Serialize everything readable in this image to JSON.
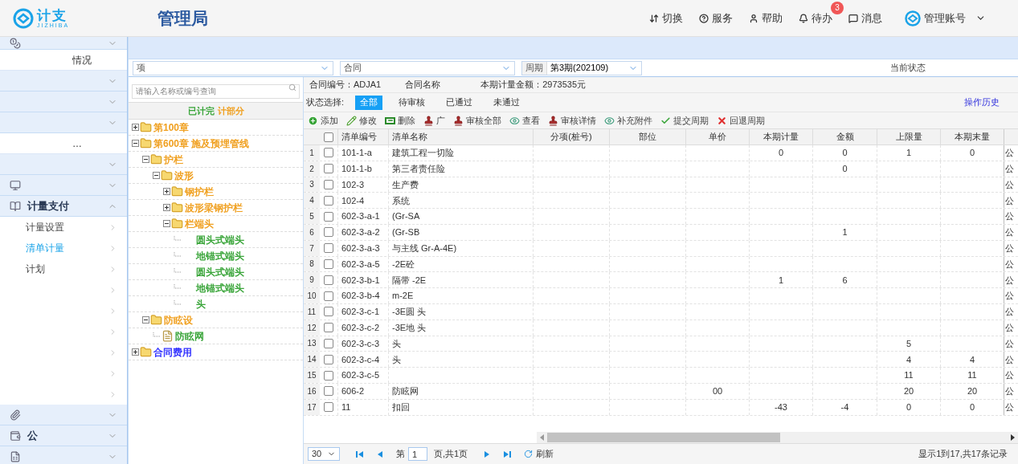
{
  "header": {
    "logo_text": "计支",
    "logo_subtext": "JIZHIBA",
    "title": "管理局",
    "nav": [
      {
        "kind": "switch",
        "label": "切换"
      },
      {
        "kind": "help",
        "label": "服务"
      },
      {
        "kind": "user",
        "label": "帮助"
      },
      {
        "kind": "bell",
        "label": "待办",
        "badge": "3"
      },
      {
        "kind": "message",
        "label": "消息"
      }
    ],
    "account": "管理账号"
  },
  "sidebar": {
    "items": [
      {
        "kind": "group",
        "expanded": false
      },
      {
        "kind": "link",
        "label": "情况",
        "selected": false
      },
      {
        "kind": "group",
        "expanded": false
      },
      {
        "kind": "group",
        "expanded": false
      },
      {
        "kind": "group",
        "expanded": false
      },
      {
        "kind": "link",
        "label": "…",
        "selected": false
      },
      {
        "kind": "group",
        "expanded": false
      },
      {
        "kind": "group",
        "expanded": false
      },
      {
        "kind": "group",
        "label": "计量支付",
        "expanded": true,
        "children": [
          {
            "label": "计量设置",
            "selected": false
          },
          {
            "label": "清单计量",
            "selected": true
          },
          {
            "label": "计划",
            "selected": false
          },
          {
            "selected": false
          },
          {
            "selected": false
          },
          {
            "selected": false
          },
          {
            "selected": false
          },
          {
            "selected": false
          },
          {
            "selected": false
          }
        ]
      },
      {
        "kind": "group",
        "expanded": false
      },
      {
        "kind": "group",
        "label": "公",
        "expanded": false
      },
      {
        "kind": "group",
        "expanded": false
      }
    ]
  },
  "filters": {
    "project_select": "项",
    "contract_select": "合同",
    "period_label": "周期",
    "period_select": "第3期(202109)",
    "status_label": "当前状态"
  },
  "tree": {
    "placeholder": "请输入名称或编号查询",
    "legend": [
      {
        "label": "已计完",
        "color": "#3aa53a"
      },
      {
        "label": "计部分",
        "color": "#f0a020"
      }
    ],
    "nodes": [
      {
        "label": "第100章",
        "kind": "folder",
        "expanded": false,
        "color": "#f0a020"
      },
      {
        "label": "第600章 施及预埋管线",
        "kind": "folder",
        "expanded": true,
        "color": "#f0a020",
        "children": [
          {
            "label": "护栏",
            "kind": "folder",
            "expanded": true,
            "color": "#f0a020",
            "children": [
              {
                "label": "波形",
                "kind": "folder",
                "expanded": true,
                "color": "#f0a020",
                "children": [
                  {
                    "label": "钢护栏",
                    "kind": "folder",
                    "expanded": false,
                    "color": "#f0a020"
                  },
                  {
                    "label": "波形梁钢护栏",
                    "kind": "folder",
                    "expanded": false,
                    "color": "#f0a020"
                  },
                  {
                    "label": "栏端头",
                    "kind": "folder",
                    "expanded": true,
                    "color": "#f0a020",
                    "children": [
                      {
                        "label": "圆头式端头",
                        "kind": "leaf",
                        "color": "#3aa53a"
                      },
                      {
                        "label": "地锚式端头",
                        "kind": "leaf",
                        "color": "#3aa53a"
                      },
                      {
                        "label": "圆头式端头",
                        "kind": "leaf",
                        "color": "#3aa53a"
                      },
                      {
                        "label": "地锚式端头",
                        "kind": "leaf",
                        "color": "#3aa53a"
                      },
                      {
                        "label": "头",
                        "kind": "leaf",
                        "color": "#3aa53a"
                      }
                    ]
                  }
                ]
              }
            ]
          },
          {
            "label": "防眩设",
            "kind": "folder",
            "expanded": true,
            "color": "#f0a020",
            "children": [
              {
                "label": "防眩网",
                "kind": "file",
                "color": "#3aa53a"
              }
            ]
          }
        ]
      },
      {
        "label": "合同费用",
        "kind": "folder",
        "expanded": false,
        "color": "#3333ff"
      }
    ]
  },
  "info": {
    "contract_no": "合同编号：ADJA1",
    "contract_name": "合同名称",
    "amount": "本期计量金额：2973535元"
  },
  "status": {
    "label": "状态选择:",
    "options": [
      {
        "label": "全部",
        "selected": true
      },
      {
        "label": "待审核",
        "selected": false
      },
      {
        "label": "已通过",
        "selected": false
      },
      {
        "label": "未通过",
        "selected": false
      }
    ],
    "history": "操作历史"
  },
  "toolbar": [
    {
      "kind": "add",
      "label": "添加"
    },
    {
      "kind": "edit",
      "label": "修改"
    },
    {
      "kind": "delete",
      "label": "删除"
    },
    {
      "kind": "stamp",
      "label": "广"
    },
    {
      "kind": "stamp",
      "label": "审核全部"
    },
    {
      "kind": "view",
      "label": "查看"
    },
    {
      "kind": "stamp",
      "label": "审核详情"
    },
    {
      "kind": "view",
      "label": "补充附件"
    },
    {
      "kind": "check",
      "label": "提交周期"
    },
    {
      "kind": "cross",
      "label": "回退周期"
    }
  ],
  "table": {
    "select_all": {
      "checked": false
    },
    "columns": [
      "清单编号",
      "清单名称",
      "分项(桩号)",
      "部位",
      "单价",
      "本期计量",
      "金额",
      "上限量",
      "本期末量"
    ],
    "rows": [
      {
        "no": "1",
        "checked": false,
        "cells": [
          "101-1-a",
          "建筑工程一切险",
          "",
          "",
          "",
          "0",
          "0",
          "1",
          "0",
          "公"
        ]
      },
      {
        "no": "2",
        "checked": false,
        "cells": [
          "101-1-b",
          "第三者责任险",
          "",
          "",
          "",
          "",
          "0",
          "",
          "",
          "公"
        ]
      },
      {
        "no": "3",
        "checked": false,
        "cells": [
          "102-3",
          "生产费",
          "",
          "",
          "",
          "",
          "",
          "",
          "",
          "公"
        ]
      },
      {
        "no": "4",
        "checked": false,
        "cells": [
          "102-4",
          "系统",
          "",
          "",
          "",
          "",
          "",
          "",
          "",
          "公"
        ]
      },
      {
        "no": "5",
        "checked": false,
        "cells": [
          "602-3-a-1",
          "(Gr-SA",
          "",
          "",
          "",
          "",
          "",
          "",
          "",
          "公"
        ]
      },
      {
        "no": "6",
        "checked": false,
        "cells": [
          "602-3-a-2",
          "(Gr-SB",
          "",
          "",
          "",
          "",
          "1",
          "",
          "",
          "公"
        ]
      },
      {
        "no": "7",
        "checked": false,
        "cells": [
          "602-3-a-3",
          "与主线 Gr-A-4E)",
          "",
          "",
          "",
          "",
          "",
          "",
          "",
          "公"
        ]
      },
      {
        "no": "8",
        "checked": false,
        "cells": [
          "602-3-a-5",
          "-2E砼",
          "",
          "",
          "",
          "",
          "",
          "",
          "",
          "公"
        ]
      },
      {
        "no": "9",
        "checked": false,
        "cells": [
          "602-3-b-1",
          "隔带 -2E",
          "",
          "",
          "",
          "1",
          "6",
          "",
          "",
          "公"
        ]
      },
      {
        "no": "10",
        "checked": false,
        "cells": [
          "602-3-b-4",
          "m-2E",
          "",
          "",
          "",
          "",
          "",
          "",
          "",
          "公"
        ]
      },
      {
        "no": "11",
        "checked": false,
        "cells": [
          "602-3-c-1",
          "-3E圆 头",
          "",
          "",
          "",
          "",
          "",
          "",
          "",
          "公"
        ]
      },
      {
        "no": "12",
        "checked": false,
        "cells": [
          "602-3-c-2",
          "-3E地 头",
          "",
          "",
          "",
          "",
          "",
          "",
          "",
          "公"
        ]
      },
      {
        "no": "13",
        "checked": false,
        "cells": [
          "602-3-c-3",
          "头",
          "",
          "",
          "",
          "",
          "",
          "5",
          "",
          "公"
        ]
      },
      {
        "no": "14",
        "checked": false,
        "cells": [
          "602-3-c-4",
          "头",
          "",
          "",
          "",
          "",
          "",
          "4",
          "4",
          "公"
        ]
      },
      {
        "no": "15",
        "checked": false,
        "cells": [
          "602-3-c-5",
          "",
          "",
          "",
          "",
          "",
          "",
          "11",
          "11",
          "公"
        ]
      },
      {
        "no": "16",
        "checked": false,
        "cells": [
          "606-2",
          "防眩网",
          "",
          "",
          "00",
          "",
          "",
          "20",
          "20",
          "公"
        ]
      },
      {
        "no": "17",
        "checked": false,
        "cells": [
          "11",
          "扣回",
          "",
          "",
          "",
          "-43",
          "-4",
          "0",
          "0",
          "公"
        ]
      }
    ]
  },
  "pager": {
    "page_size": "30",
    "page_prefix": "第",
    "page": "1",
    "page_suffix": "页,共1页",
    "refresh": "刷新",
    "summary": "显示1到17,共17条记录"
  }
}
